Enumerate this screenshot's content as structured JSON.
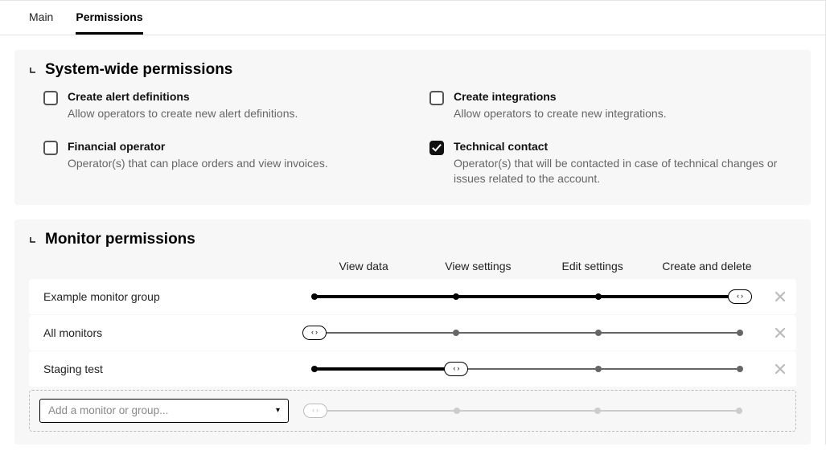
{
  "tabs": {
    "main": "Main",
    "permissions": "Permissions"
  },
  "system_wide": {
    "title": "System-wide permissions",
    "create_alert_title": "Create alert definitions",
    "create_alert_desc": "Allow operators to create new alert definitions.",
    "create_alert_checked": false,
    "create_integrations_title": "Create integrations",
    "create_integrations_desc": "Allow operators to create new integrations.",
    "create_integrations_checked": false,
    "financial_title": "Financial operator",
    "financial_desc": "Operator(s) that can place orders and view invoices.",
    "financial_checked": false,
    "tech_title": "Technical contact",
    "tech_desc": "Operator(s) that will be contacted in case of technical changes or issues related to the account.",
    "tech_checked": true
  },
  "monitor": {
    "title": "Monitor permissions",
    "columns": {
      "view_data": "View data",
      "view_settings": "View settings",
      "edit_settings": "Edit settings",
      "create_delete": "Create and delete"
    },
    "rows": {
      "r0": {
        "name": "Example monitor group",
        "level": 3
      },
      "r1": {
        "name": "All monitors",
        "level": 0
      },
      "r2": {
        "name": "Staging test",
        "level": 1
      }
    },
    "add_placeholder": "Add a monitor or group..."
  }
}
